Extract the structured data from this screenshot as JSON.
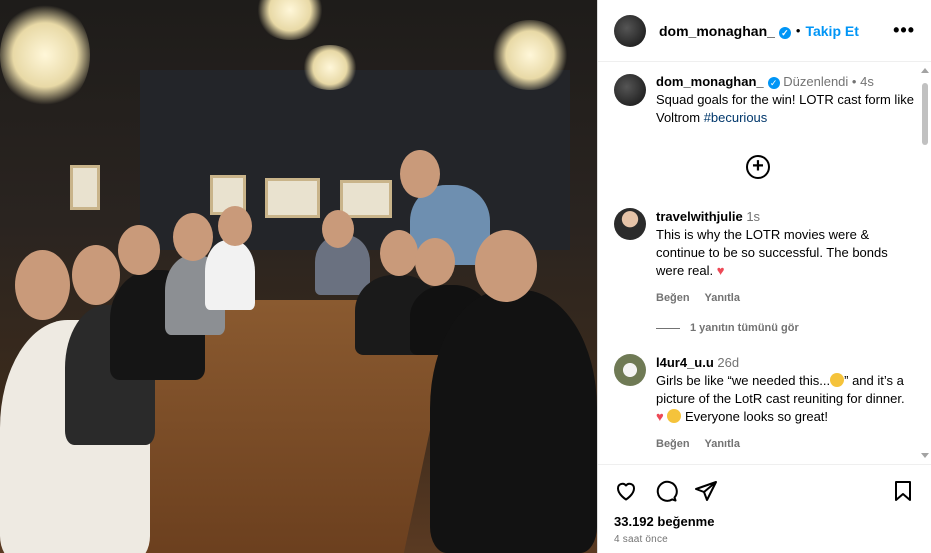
{
  "post": {
    "username": "dom_monaghan_",
    "follow_label": "Takip Et",
    "more_label": "•••"
  },
  "caption": {
    "username": "dom_monaghan_",
    "edited": "Düzenlendi",
    "age": "4s",
    "text": "Squad goals for the win! LOTR cast form like Voltrom ",
    "hashtag": "#becurious"
  },
  "load_more_label": "+",
  "comments": [
    {
      "username": "travelwithjulie",
      "age": "1s",
      "text": "This is why the LOTR movies were & continue to be so successful. The bonds were real.",
      "emoji": "heart",
      "like_label": "Beğen",
      "reply_label": "Yanıtla",
      "view_replies": "1 yanıtın tümünü gör"
    },
    {
      "username": "l4ur4_u.u",
      "age": "26d",
      "text_before": "Girls be like “we needed this...",
      "text_middle": "” and it’s a picture of the LotR cast reuniting for dinner.",
      "text_after": " Everyone looks so great!",
      "like_label": "Beğen",
      "reply_label": "Yanıtla"
    }
  ],
  "footer": {
    "likes": "33.192 beğenme",
    "time": "4 saat önce"
  },
  "colors": {
    "accent": "#0095f6",
    "heart": "#ed4956",
    "meta_text": "#737373"
  }
}
